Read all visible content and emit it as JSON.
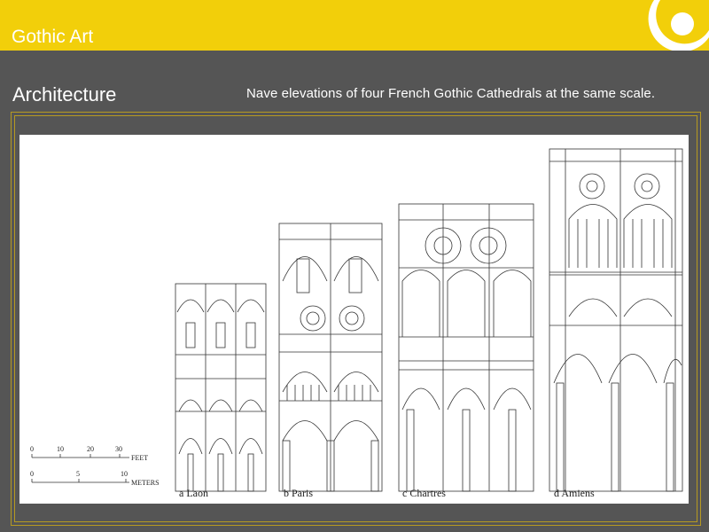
{
  "header": {
    "title": "Gothic Art"
  },
  "slide": {
    "section_title": "Architecture",
    "caption": "Nave elevations of four French Gothic Cathedrals at the same scale."
  },
  "figure": {
    "scale": {
      "feet_ticks": [
        "0",
        "10",
        "20",
        "30"
      ],
      "feet_unit": "FEET",
      "meter_ticks": [
        "0",
        "5",
        "10"
      ],
      "meter_unit": "METERS"
    },
    "labels": [
      "a  Laon",
      "b  Paris",
      "c  Chartres",
      "d  Amiens"
    ]
  },
  "colors": {
    "accent": "#f2cf0a",
    "background": "#555555",
    "frame": "#b69a22"
  }
}
